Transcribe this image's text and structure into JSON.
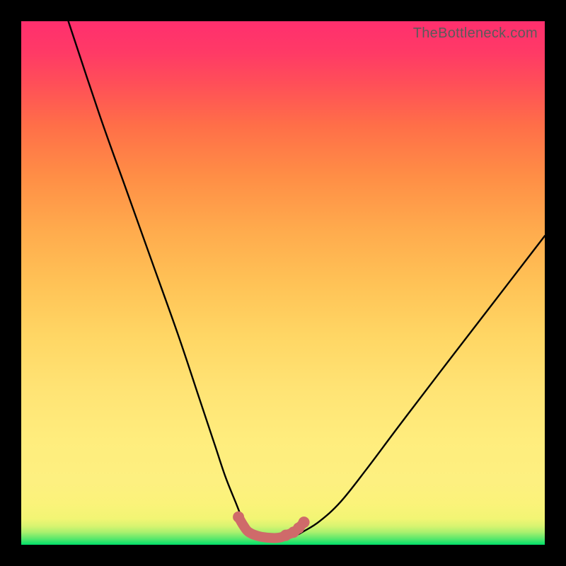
{
  "watermark": "TheBottleneck.com",
  "chart_data": {
    "type": "line",
    "title": "",
    "xlabel": "",
    "ylabel": "",
    "xlim": [
      0,
      100
    ],
    "ylim": [
      0,
      100
    ],
    "series": [
      {
        "name": "main-curve",
        "color": "#000000",
        "x": [
          9,
          15,
          20,
          25,
          30,
          34,
          37,
          39,
          41,
          42,
          43,
          44,
          46,
          48,
          49,
          50,
          52,
          54,
          57,
          61,
          66,
          72,
          80,
          90,
          100
        ],
        "y": [
          100,
          82,
          68,
          54,
          40,
          28,
          19,
          13,
          8,
          5.5,
          3.5,
          2.4,
          1.6,
          1.3,
          1.3,
          1.3,
          1.6,
          2.6,
          4.5,
          8.2,
          14.5,
          22.5,
          33,
          46,
          59
        ]
      },
      {
        "name": "bottom-overlay",
        "color": "#cf6a6a",
        "x": [
          41.5,
          42.5,
          43.5,
          45.5,
          48.0,
          49.5,
          50.5,
          52.0,
          53.0,
          54.0
        ],
        "y": [
          5.3,
          3.6,
          2.4,
          1.6,
          1.3,
          1.4,
          1.8,
          2.4,
          3.2,
          4.3
        ]
      }
    ],
    "markers": [
      {
        "name": "bottom-dot",
        "x": 41.5,
        "y": 5.3,
        "color": "#cf6a6a"
      },
      {
        "name": "bottom-dot",
        "x": 50.5,
        "y": 1.8,
        "color": "#cf6a6a"
      },
      {
        "name": "bottom-dot",
        "x": 52.0,
        "y": 2.4,
        "color": "#cf6a6a"
      },
      {
        "name": "bottom-dot",
        "x": 53.0,
        "y": 3.2,
        "color": "#cf6a6a"
      },
      {
        "name": "bottom-dot",
        "x": 54.0,
        "y": 4.3,
        "color": "#cf6a6a"
      }
    ]
  }
}
